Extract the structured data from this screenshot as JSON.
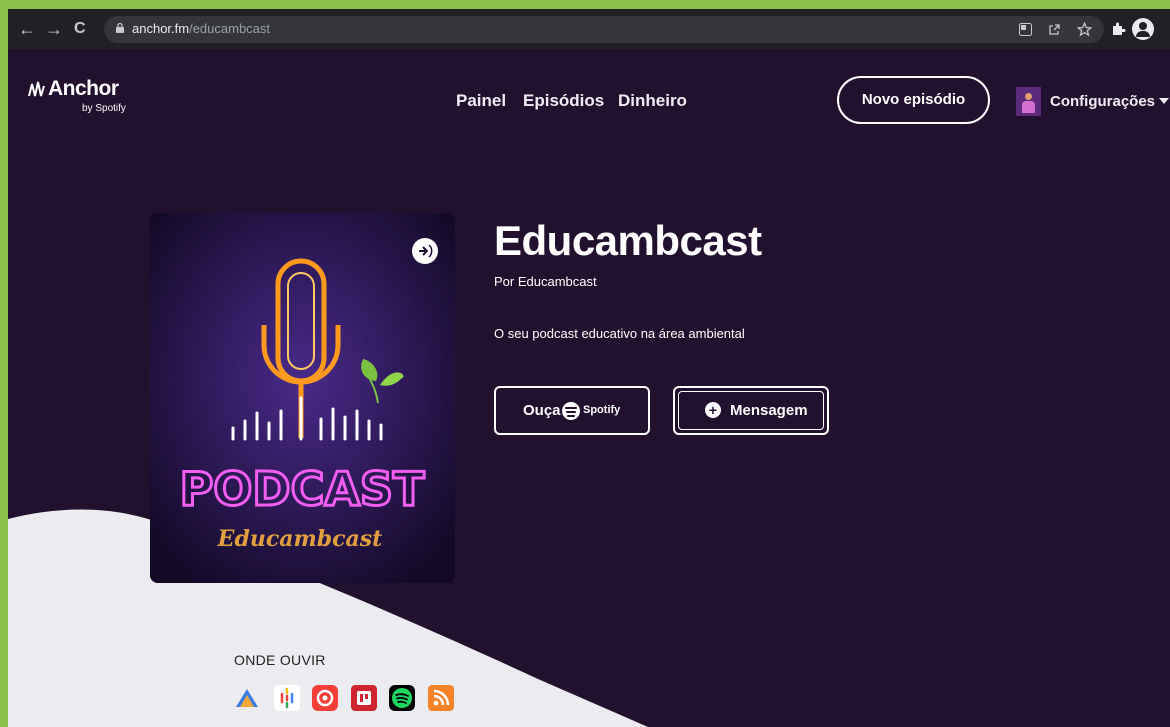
{
  "browser": {
    "url_host": "anchor.fm",
    "url_path": "/educambcast",
    "back_icon": "←",
    "forward_icon": "→",
    "reload_icon": "C"
  },
  "header": {
    "logo_text": "Anchor",
    "logo_sub": "by Spotify",
    "nav": [
      "Painel",
      "Episódios",
      "Dinheiro"
    ],
    "new_episode": "Novo episódio",
    "settings": "Configurações"
  },
  "cover": {
    "word": "PODCAST",
    "name": "Educambcast"
  },
  "podcast": {
    "title": "Educambcast",
    "byline": "Por Educambcast",
    "description": "O seu podcast educativo na área ambiental",
    "listen_label": "Ouça",
    "spotify_label": "Spotify",
    "message_label": "Mensagem"
  },
  "where_listen": {
    "heading": "ONDE OUVIR",
    "platforms": [
      "Breaker",
      "Google Podcasts",
      "Pocket Casts",
      "RadioPublic",
      "Spotify",
      "RSS"
    ]
  },
  "colors": {
    "page_bg": "#22112e",
    "outer_frame": "#8bc34a",
    "chrome": "#202124",
    "neon_orange": "#ff9a1f",
    "neon_pink": "#f25ef2"
  }
}
